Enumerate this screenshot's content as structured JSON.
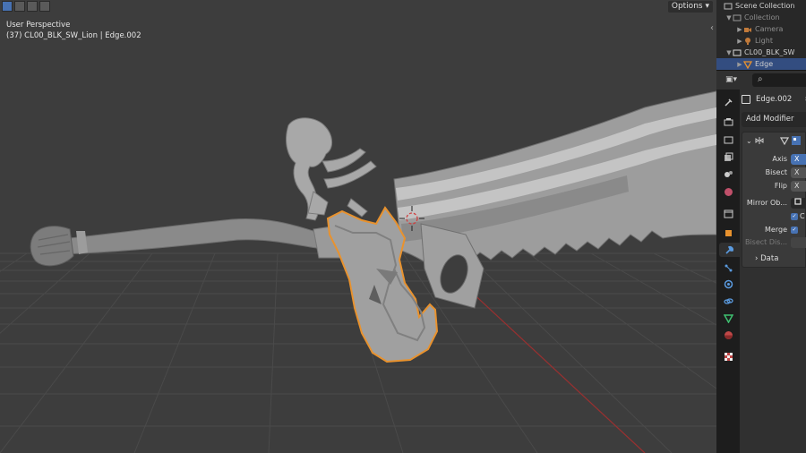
{
  "viewport": {
    "options_label": "Options",
    "view_name": "User Perspective",
    "object_info": "(37) CL00_BLK_SW_Lion | Edge.002"
  },
  "outliner": {
    "scene_collection": "Scene Collection",
    "collection": "Collection",
    "camera": "Camera",
    "light": "Light",
    "object": "CL00_BLK_SW",
    "mesh": "Edge"
  },
  "properties": {
    "object_name": "Edge.002",
    "add_modifier": "Add Modifier",
    "mirror": {
      "axis_label": "Axis",
      "axis_value": "X",
      "bisect_label": "Bisect",
      "bisect_value": "X",
      "flip_label": "Flip",
      "flip_value": "X",
      "mirror_object_label": "Mirror Ob...",
      "clipping_label": "C",
      "merge_label": "Merge",
      "bisect_distance_label": "Bisect Dis...",
      "data_label": "Data"
    }
  },
  "colors": {
    "viewport_bg": "#3d3d3d",
    "selection_outline": "#e8922e",
    "accent_blue": "#4772b3",
    "axis_red": "#9a3030"
  },
  "icons": [
    "select-box-icon",
    "select-extend-icon",
    "select-subtract-icon",
    "select-intersect-icon",
    "editor-type-icon",
    "search-icon",
    "tool-icon",
    "render-icon",
    "output-icon",
    "view-layer-icon",
    "scene-icon",
    "world-icon",
    "collection-icon",
    "object-icon",
    "modifier-icon",
    "particles-icon",
    "physics-icon",
    "constraints-icon",
    "data-icon",
    "material-icon",
    "texture-icon"
  ]
}
